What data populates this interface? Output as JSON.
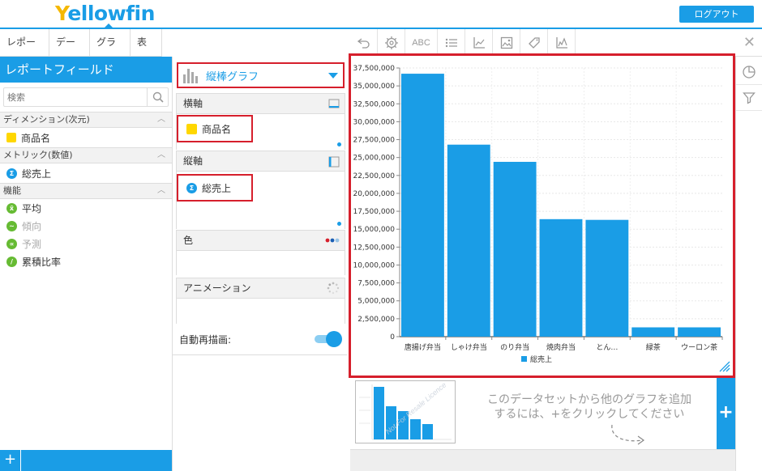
{
  "header": {
    "logo_y": "Y",
    "logo_rest": "ellowfin",
    "logout_label": "ログアウト"
  },
  "tabs": [
    {
      "label": "レポート"
    },
    {
      "label": "データ"
    },
    {
      "label": "グラフ"
    },
    {
      "label": "表示"
    }
  ],
  "toolbar": {
    "text_button_label": "ABC"
  },
  "left_panel": {
    "title": "レポートフィールド",
    "search_placeholder": "検索",
    "sections": [
      {
        "heading": "ディメンション(次元)",
        "items": [
          {
            "label": "商品名",
            "icon": "yellow-square"
          }
        ]
      },
      {
        "heading": "メトリック(数値)",
        "items": [
          {
            "label": "総売上",
            "icon": "sigma"
          }
        ]
      },
      {
        "heading": "機能",
        "items": [
          {
            "label": "平均",
            "icon": "average"
          },
          {
            "label": "傾向",
            "icon": "trend"
          },
          {
            "label": "予測",
            "icon": "forecast"
          },
          {
            "label": "累積比率",
            "icon": "cumulative"
          }
        ]
      }
    ]
  },
  "middle_panel": {
    "chart_type_label": "縦棒グラフ",
    "x_axis": {
      "heading": "横軸",
      "field": "商品名"
    },
    "y_axis": {
      "heading": "縦軸",
      "field": "総売上"
    },
    "color": {
      "heading": "色"
    },
    "animation": {
      "heading": "アニメーション"
    },
    "auto_redraw": {
      "label": "自動再描画:",
      "on": true
    }
  },
  "bottom": {
    "hint_line1": "このデータセットから他のグラフを追加",
    "hint_line2": "するには、+をクリックしてください",
    "add_label": "+",
    "thumb_watermark": "Not For Resale Licence"
  },
  "colors": {
    "accent": "#1a9de6",
    "highlight": "#d61f2c",
    "logo_y": "#f5b800",
    "bar": "#1a9de6"
  },
  "chart_data": {
    "type": "bar",
    "categories": [
      "唐揚げ弁当",
      "しゃけ弁当",
      "のり弁当",
      "焼肉弁当",
      "とん…",
      "緑茶",
      "ウーロン茶"
    ],
    "series": [
      {
        "name": "総売上",
        "values": [
          36700000,
          26800000,
          24400000,
          16400000,
          16300000,
          1300000,
          1300000
        ]
      }
    ],
    "ylim": [
      0,
      37500000
    ],
    "yticks": [
      "0",
      "2,500,000",
      "5,000,000",
      "7,500,000",
      "10,000,000",
      "12,500,000",
      "15,000,000",
      "17,500,000",
      "20,000,000",
      "22,500,000",
      "25,000,000",
      "27,500,000",
      "30,000,000",
      "32,500,000",
      "35,000,000",
      "37,500,000"
    ],
    "grid": true,
    "legend": "bottom-center"
  }
}
